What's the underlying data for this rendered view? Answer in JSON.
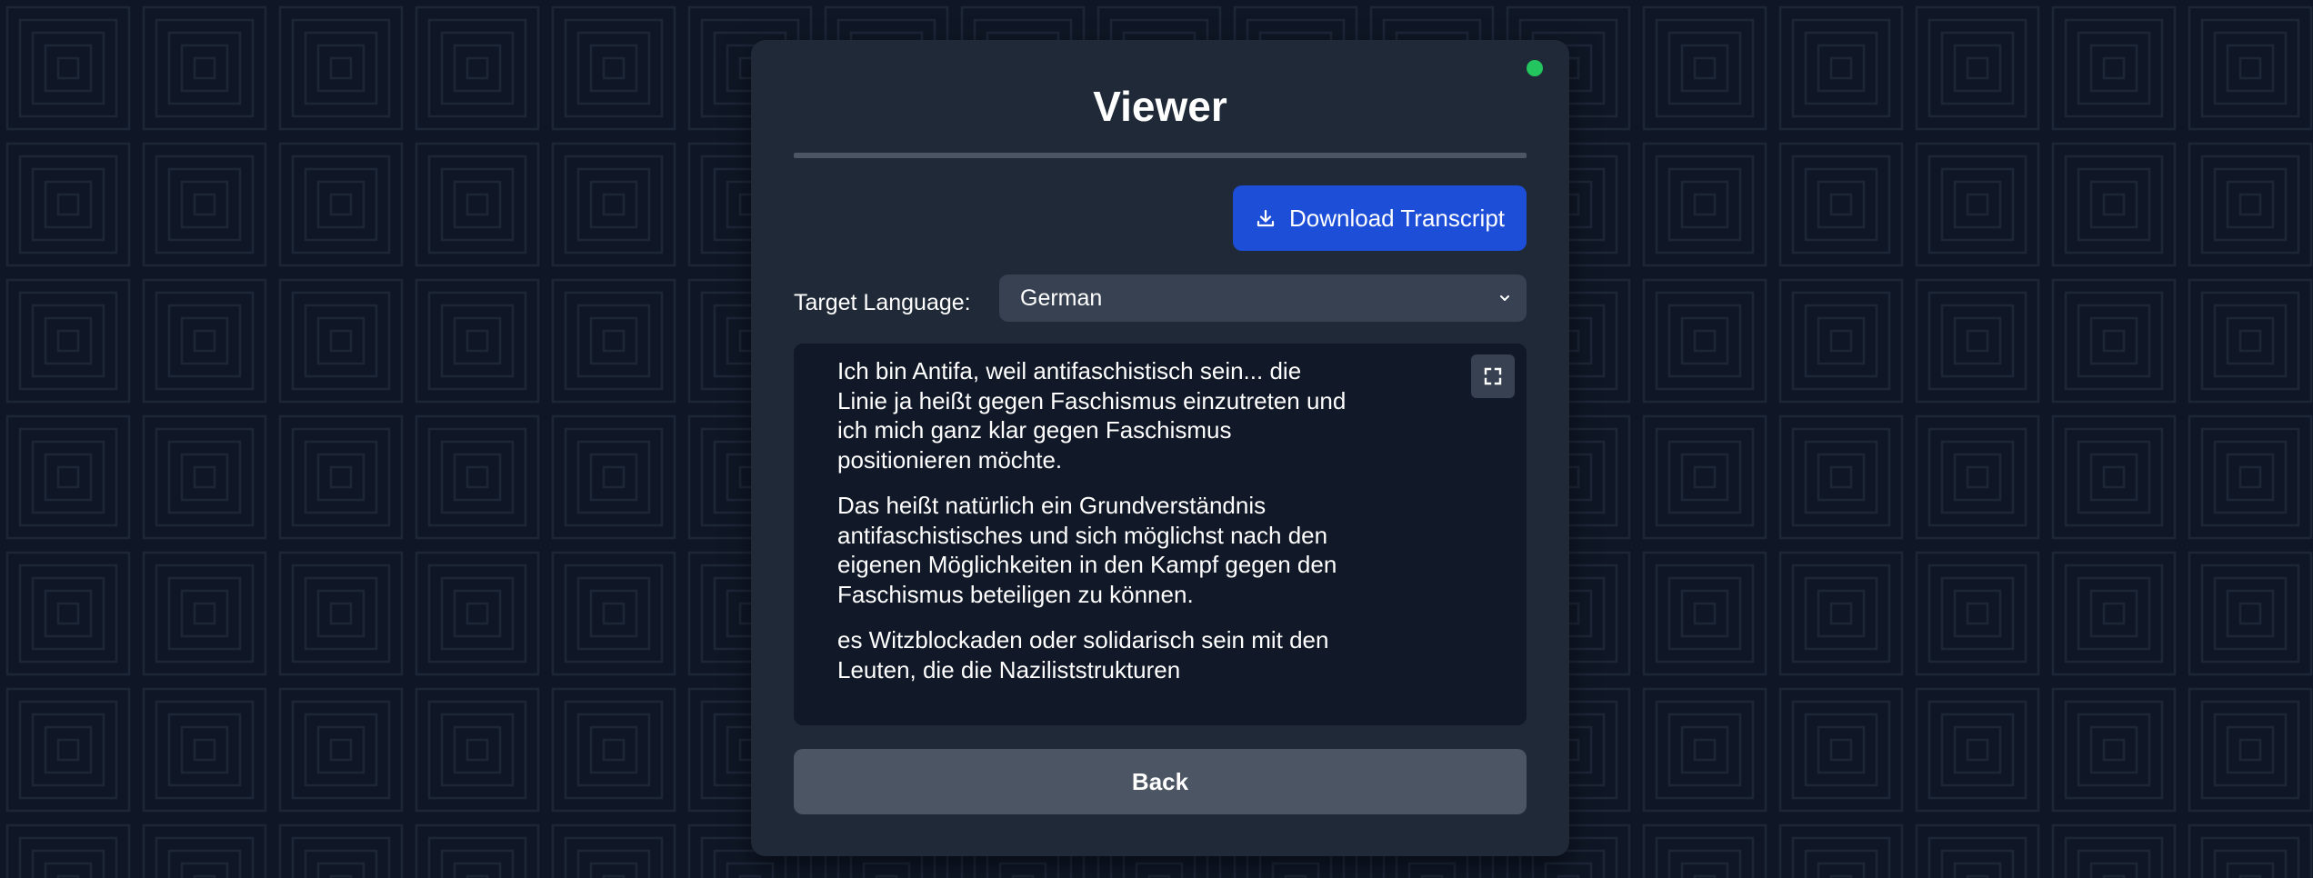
{
  "colors": {
    "background": "#0f1726",
    "card": "#1f2937",
    "primary_button": "#1d4ed8",
    "secondary_button": "#4b5563",
    "transcript_bg": "#111827",
    "status_dot": "#22c55e"
  },
  "viewer": {
    "title": "Viewer",
    "status_indicator": "online-status-dot"
  },
  "toolbar": {
    "download_label": "Download Transcript",
    "download_icon": "download-icon"
  },
  "language": {
    "label": "Target Language:",
    "selected": "German",
    "dropdown_icon": "chevron-down-icon"
  },
  "transcript": {
    "expand_icon": "fullscreen-icon",
    "paragraphs": [
      "Ich bin Antifa, weil antifaschistisch sein... die Linie ja heißt gegen Faschismus einzutreten und ich mich ganz klar gegen Faschismus positionieren möchte.",
      "Das heißt natürlich ein Grundverständnis antifaschistisches und sich möglichst nach den eigenen Möglichkeiten in den Kampf gegen den Faschismus beteiligen zu können.",
      "es Witzblockaden oder solidarisch sein mit den Leuten, die die Naziliststrukturen"
    ]
  },
  "footer": {
    "back_label": "Back"
  }
}
